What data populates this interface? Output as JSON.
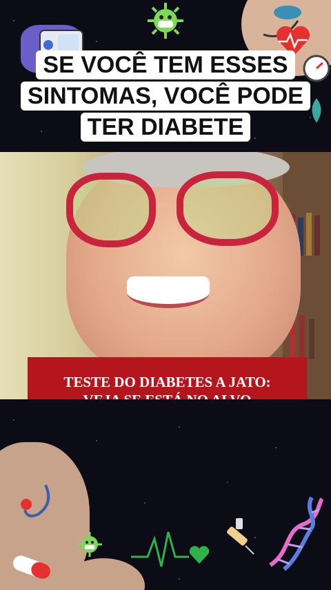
{
  "title": {
    "line1": "SE VOCÊ TEM ESSES",
    "line2": "SINTOMAS, VOCÊ PODE",
    "line3": "TER DIABETE"
  },
  "video": {
    "card_line1": "TESTE DO DIABETES A JATO:",
    "card_line2": "VEJA SE ESTÁ NO ALVO"
  },
  "icons": {
    "top": [
      "virus-icon",
      "blood-pressure-monitor-icon",
      "stethoscope-icon",
      "heart-icon",
      "gauge-icon"
    ],
    "bottom": [
      "stethoscope-icon",
      "pill-icon",
      "virus-icon",
      "heartbeat-icon",
      "syringe-icon",
      "dna-icon"
    ]
  },
  "colors": {
    "title_bg": "#ffffff",
    "card_bg": "#b5161e",
    "space_bg": "#0c0c16",
    "glasses": "#c8243e"
  }
}
